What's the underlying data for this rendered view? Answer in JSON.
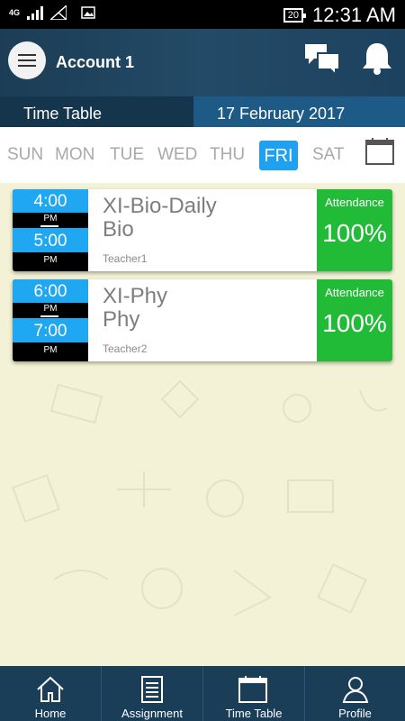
{
  "status_bar": {
    "network": "4G",
    "battery": "20",
    "time": "12:31 AM"
  },
  "header": {
    "title": "Account 1"
  },
  "title_bar": {
    "section": "Time Table",
    "date": "17 February 2017"
  },
  "days": {
    "sun": "SUN",
    "mon": "MON",
    "tue": "TUE",
    "wed": "WED",
    "thu": "THU",
    "fri": "FRI",
    "sat": "SAT",
    "selected": "FRI"
  },
  "classes": [
    {
      "start": "4:00",
      "start_period": "PM",
      "end": "5:00",
      "end_period": "PM",
      "title": "XI-Bio-Daily",
      "subject": "Bio",
      "teacher": "Teacher1",
      "attendance_label": "Attendance",
      "attendance": "100%"
    },
    {
      "start": "6:00",
      "start_period": "PM",
      "end": "7:00",
      "end_period": "PM",
      "title": "XI-Phy",
      "subject": "Phy",
      "teacher": "Teacher2",
      "attendance_label": "Attendance",
      "attendance": "100%"
    }
  ],
  "bottom_nav": {
    "home": "Home",
    "assignment": "Assignment",
    "timetable": "Time Table",
    "profile": "Profile"
  },
  "colors": {
    "header_bg": "#1c3d55",
    "accent_blue": "#1ea1f1",
    "attendance_green": "#22bb38",
    "page_bg": "#f3f2d6"
  },
  "icons": {
    "menu": "hamburger-icon",
    "chat": "chat-icon",
    "notifications": "bell-icon",
    "calendar": "calendar-icon",
    "home": "home-icon",
    "assignment": "assignment-icon",
    "timetable": "timetable-icon",
    "profile": "profile-icon"
  }
}
